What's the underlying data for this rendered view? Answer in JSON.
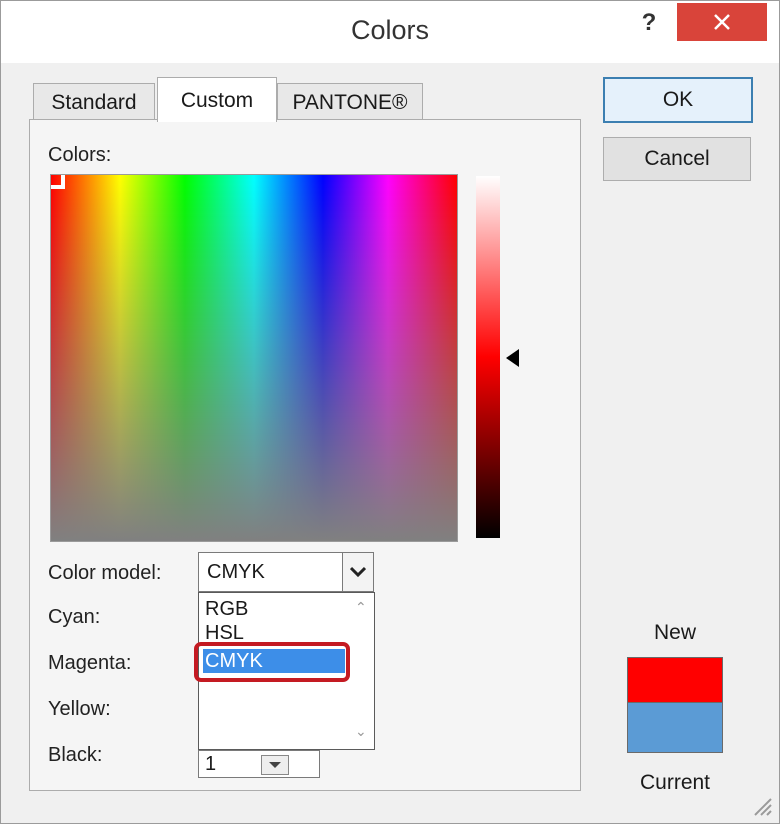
{
  "window": {
    "title": "Colors",
    "help_label": "?",
    "close_icon": "close-icon"
  },
  "tabs": [
    {
      "label": "Standard",
      "active": false
    },
    {
      "label": "Custom",
      "active": true
    },
    {
      "label": "PANTONE®",
      "active": false
    }
  ],
  "custom": {
    "colors_label": "Colors:",
    "color_model_label": "Color model:",
    "color_model_value": "CMYK",
    "color_model_options": [
      "RGB",
      "HSL",
      "CMYK"
    ],
    "highlighted_option": "CMYK",
    "fields": {
      "cyan_label": "Cyan:",
      "magenta_label": "Magenta:",
      "yellow_label": "Yellow:",
      "black_label": "Black:",
      "black_value": "1"
    }
  },
  "buttons": {
    "ok_label": "OK",
    "cancel_label": "Cancel"
  },
  "preview": {
    "new_label": "New",
    "current_label": "Current",
    "new_color": "#ff0000",
    "current_color": "#5b9bd5"
  },
  "colors": {
    "close_button": "#d9443a",
    "selection": "#3d8ee8",
    "highlight_border": "#c41a22"
  }
}
